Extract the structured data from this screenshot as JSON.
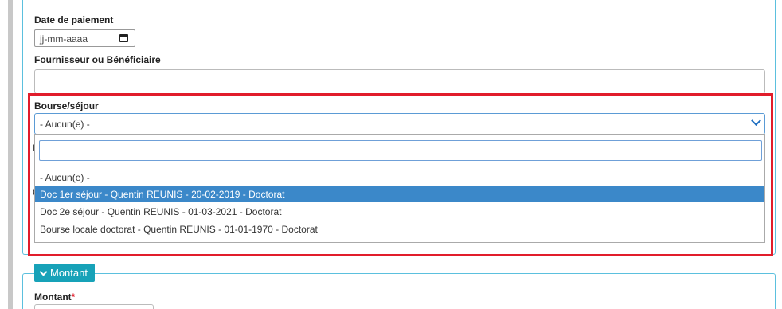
{
  "form": {
    "date_paiement_label": "Date de paiement",
    "date_placeholder": "jj-mm-aaaa",
    "fournisseur_label": "Fournisseur ou Bénéficiaire",
    "bourse_label": "Bourse/séjour",
    "bourse_selected": "- Aucun(e) -",
    "bourse_options": [
      "- Aucun(e) -",
      "Doc 1er séjour - Quentin REUNIS - 20-02-2019 - Doctorat",
      "Doc 2e séjour - Quentin REUNIS - 01-03-2021 - Doctorat",
      "Bourse locale doctorat - Quentin REUNIS - 01-01-1970 - Doctorat"
    ],
    "hidden_label_fragments": [
      "I",
      "("
    ]
  },
  "montant_section": {
    "toggle_label": "Montant",
    "field_label": "Montant",
    "required_mark": "*"
  },
  "colors": {
    "highlight_frame": "#e11d2b",
    "selected_option": "#3b88c9",
    "section_accent": "#17a2b8"
  }
}
